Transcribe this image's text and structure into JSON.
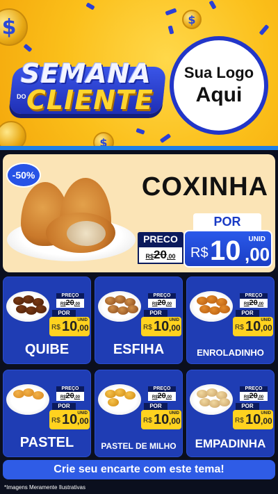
{
  "header": {
    "title_top": "SEMANA",
    "title_connector": "DO",
    "title_bottom": "CLIENTE",
    "logo_line1": "Sua Logo",
    "logo_line2": "Aqui",
    "coin_symbol": "$",
    "background_color": "#fbbf1a",
    "accent_color": "#2236c8"
  },
  "featured": {
    "discount": "-50%",
    "name": "COXINHA",
    "price_label": "PRECO",
    "old_price_currency": "R$",
    "old_price_int": "20",
    "old_price_dec": ",00",
    "por_label": "POR",
    "unit_label": "UNID",
    "currency": "R$",
    "new_price_int": "10",
    "new_price_dec": ",00"
  },
  "products": [
    {
      "name": "QUIBE",
      "price_label": "PREÇO",
      "old_price_currency": "R$",
      "old_price_int": "20",
      "old_price_dec": ",00",
      "por_label": "POR",
      "unit_label": "UNID",
      "currency": "R$",
      "new_price_int": "10",
      "new_price_dec": ",00"
    },
    {
      "name": "ESFIHA",
      "price_label": "PREÇO",
      "old_price_currency": "R$",
      "old_price_int": "20",
      "old_price_dec": ",00",
      "por_label": "POR",
      "unit_label": "UNID",
      "currency": "R$",
      "new_price_int": "10",
      "new_price_dec": ",00"
    },
    {
      "name": "ENROLADINHO",
      "price_label": "PREÇO",
      "old_price_currency": "R$",
      "old_price_int": "20",
      "old_price_dec": ",00",
      "por_label": "POR",
      "unit_label": "UNID",
      "currency": "R$",
      "new_price_int": "10",
      "new_price_dec": ",00"
    },
    {
      "name": "PASTEL",
      "price_label": "PREÇO",
      "old_price_currency": "R$",
      "old_price_int": "20",
      "old_price_dec": ",00",
      "por_label": "POR",
      "unit_label": "UNID",
      "currency": "R$",
      "new_price_int": "10",
      "new_price_dec": ",00"
    },
    {
      "name": "PASTEL DE MILHO",
      "price_label": "PREÇO",
      "old_price_currency": "R$",
      "old_price_int": "20",
      "old_price_dec": ",00",
      "por_label": "POR",
      "unit_label": "UNID",
      "currency": "R$",
      "new_price_int": "10",
      "new_price_dec": ",00"
    },
    {
      "name": "EMPADINHA",
      "price_label": "PREÇO",
      "old_price_currency": "R$",
      "old_price_int": "20",
      "old_price_dec": ",00",
      "por_label": "POR",
      "unit_label": "UNID",
      "currency": "R$",
      "new_price_int": "10",
      "new_price_dec": ",00"
    }
  ],
  "footer": {
    "cta": "Crie seu encarte com este tema!",
    "disclaimer": "*Imagens Meramente Ilustrativas"
  }
}
